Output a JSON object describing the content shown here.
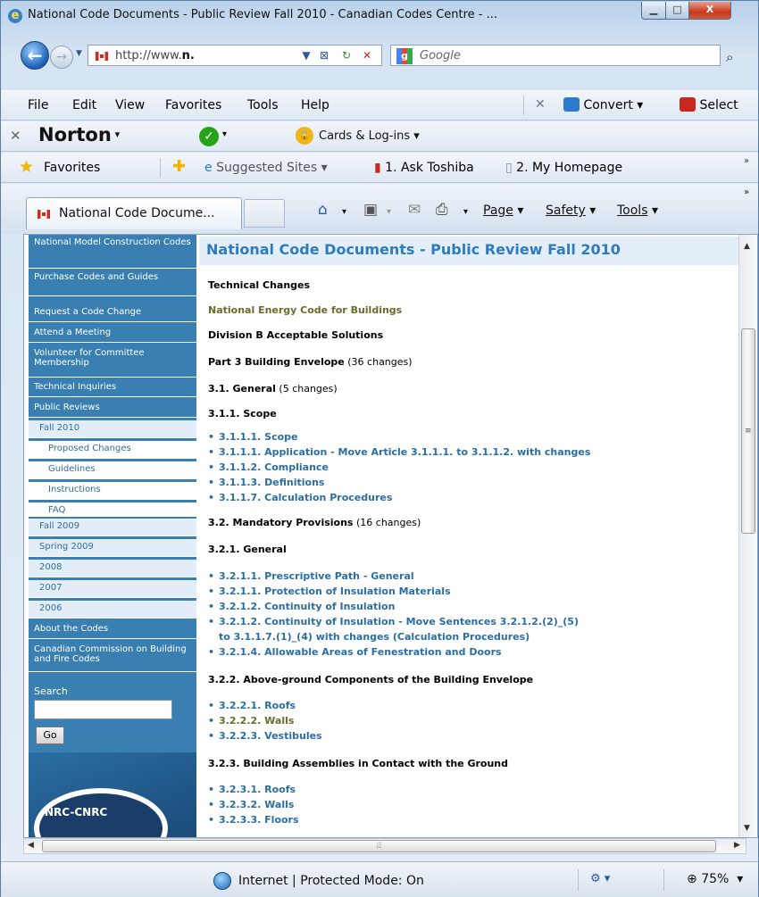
{
  "window": {
    "title": "National Code Documents - Public Review Fall 2010 - Canadian Codes Centre - ...",
    "min_label": "▁",
    "max_label": "□",
    "close_label": "X"
  },
  "address_bar": {
    "url_prefix": "http://www.",
    "url_bold": "n.",
    "search_placeholder": "Google"
  },
  "menu": {
    "file": "File",
    "edit": "Edit",
    "view": "View",
    "favorites": "Favorites",
    "tools": "Tools",
    "help": "Help",
    "convert": "Convert",
    "select": "Select"
  },
  "norton_bar": {
    "brand": "Norton",
    "cards": "Cards & Log-ins"
  },
  "favorites_bar": {
    "favorites": "Favorites",
    "suggested": "Suggested Sites",
    "ask": "1. Ask Toshiba",
    "homepage": "2. My Homepage"
  },
  "tab": {
    "title": "National Code Docume..."
  },
  "command_bar": {
    "page": "Page",
    "safety": "Safety",
    "tools": "Tools"
  },
  "sidebar": {
    "items": [
      {
        "label": "National Model Construction Codes"
      },
      {
        "label": "Purchase Codes and Guides"
      },
      {
        "label": "Request a Code Change"
      },
      {
        "label": "Attend a Meeting"
      },
      {
        "label": "Volunteer for Committee Membership"
      },
      {
        "label": "Technical Inquiries"
      },
      {
        "label": "Public Reviews"
      },
      {
        "label": "Fall 2010"
      },
      {
        "label": "Proposed Changes"
      },
      {
        "label": "Guidelines"
      },
      {
        "label": "Instructions"
      },
      {
        "label": "FAQ"
      },
      {
        "label": "Fall 2009"
      },
      {
        "label": "Spring 2009"
      },
      {
        "label": "2008"
      },
      {
        "label": "2007"
      },
      {
        "label": "2006"
      },
      {
        "label": "About the Codes"
      },
      {
        "label": "Canadian Commission on Building and Fire Codes"
      }
    ],
    "search_label": "Search",
    "go_label": "Go",
    "logo_text": "NRC-CNRC"
  },
  "main": {
    "title": "National Code Documents - Public Review Fall 2010",
    "technical_changes": "Technical Changes",
    "energy_code": "National Energy Code for Buildings",
    "division": "Division B Acceptable Solutions",
    "part3": "Part 3 Building Envelope",
    "part3_count": " (36 changes)",
    "s31": "3.1. General",
    "s31_count": " (5 changes)",
    "s311": "3.1.1. Scope",
    "s311_items": [
      "3.1.1.1. Scope",
      "3.1.1.1. Application - Move Article 3.1.1.1. to 3.1.1.2. with changes",
      "3.1.1.2. Compliance",
      "3.1.1.3. Definitions",
      "3.1.1.7. Calculation Procedures"
    ],
    "s32": "3.2. Mandatory Provisions",
    "s32_count": " (16 changes)",
    "s321": "3.2.1. General",
    "s321_items": [
      "3.2.1.1. Prescriptive Path - General",
      "3.2.1.1. Protection of Insulation Materials",
      "3.2.1.2. Continuity of Insulation",
      "3.2.1.2. Continuity of Insulation - Move Sentences 3.2.1.2.(2)_(5)",
      "to 3.1.1.7.(1)_(4) with changes (Calculation Procedures)",
      "3.2.1.4. Allowable Areas of Fenestration and Doors"
    ],
    "s322": "3.2.2. Above-ground Components of the Building Envelope",
    "s322_items": [
      "3.2.2.1. Roofs",
      "3.2.2.2. Walls",
      "3.2.2.3. Vestibules"
    ],
    "s323": "3.2.3. Building Assemblies in Contact with the Ground",
    "s323_items": [
      "3.2.3.1. Roofs",
      "3.2.3.2. Walls",
      "3.2.3.3. Floors"
    ]
  },
  "status": {
    "zone": "Internet | Protected Mode: On",
    "zoom": "75%"
  },
  "colors": {
    "sidebar_blue": "#2f6e9f",
    "title_blue": "#2f7bbf",
    "link_blue": "#2b6ea3",
    "olive": "#6b6b2a"
  }
}
